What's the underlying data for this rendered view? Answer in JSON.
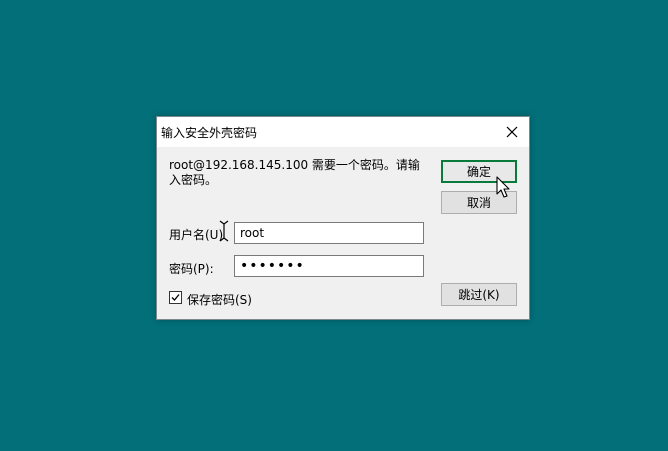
{
  "dialog": {
    "title": "输入安全外壳密码",
    "message": "root@192.168.145.100 需要一个密码。请输入密码。",
    "username_label": "用户名(U)",
    "username_value": "root",
    "password_label": "密码(P):",
    "password_value": "•••••••",
    "save_password_label": "保存密码(S)",
    "save_password_checked": true,
    "ok_label": "确定",
    "cancel_label": "取消",
    "skip_label": "跳过(K)"
  },
  "colors": {
    "desktop": "#036f79",
    "dialog_bg": "#f0f0f0",
    "highlight": "#fff53c",
    "default_button_border": "#0a7a3a"
  },
  "icons": {
    "close": "close-icon",
    "check": "checkmark-icon",
    "cursor": "mouse-pointer-icon",
    "text_cursor": "text-cursor-icon"
  }
}
